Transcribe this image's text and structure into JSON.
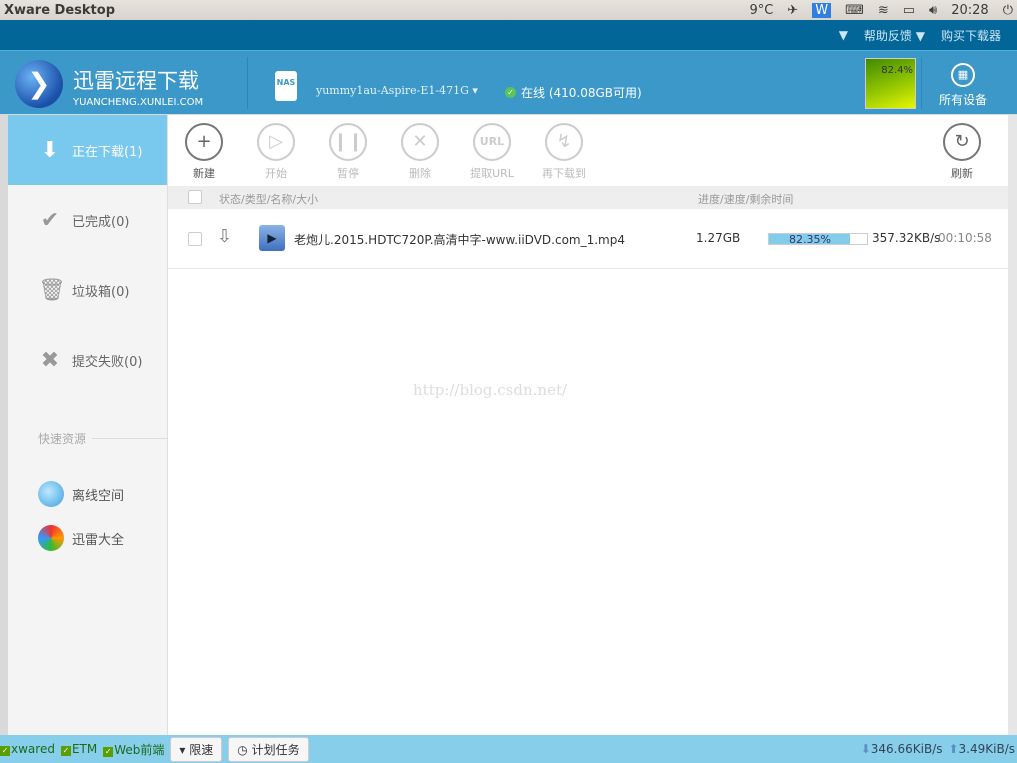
{
  "window": {
    "title": "Xware Desktop",
    "temp": "9°C",
    "clock": "20:28"
  },
  "topnav": {
    "help": "帮助反馈",
    "buy": "购买下载器"
  },
  "header": {
    "brand_cn": "迅雷远程下载",
    "brand_en": "YUANCHENG.XUNLEI.COM",
    "nas": "NAS",
    "device": "yummy1au-Aspire-E1-471G",
    "status": "在线 (410.08GB可用)",
    "graph_label": "82.4%",
    "all_devices": "所有设备"
  },
  "sidebar": {
    "items": [
      {
        "label": "正在下载(1)"
      },
      {
        "label": "已完成(0)"
      },
      {
        "label": "垃圾箱(0)"
      },
      {
        "label": "提交失败(0)"
      }
    ],
    "quick_label": "快速资源",
    "quick": [
      {
        "label": "离线空间"
      },
      {
        "label": "迅雷大全"
      }
    ]
  },
  "toolbar": {
    "new": "新建",
    "start": "开始",
    "pause": "暂停",
    "delete": "删除",
    "url_icon": "URL",
    "extract": "提取URL",
    "redownload": "再下载到",
    "refresh": "刷新"
  },
  "table": {
    "col1": "状态/类型/名称/大小",
    "col2": "进度/速度/剩余时间"
  },
  "task": {
    "name": "老炮儿.2015.HDTC720P.高清中字-www.iiDVD.com_1.mp4",
    "size": "1.27GB",
    "progress_pct": 82.35,
    "progress": "82.35%",
    "speed": "357.32KB/s",
    "remaining": "00:10:58"
  },
  "watermark": "http://blog.csdn.net/",
  "bottom": {
    "xwared": "xwared",
    "etm": "ETM",
    "web": "Web前端",
    "limit": "限速",
    "schedule": "计划任务",
    "down": "346.66KiB/s",
    "up": "3.49KiB/s"
  }
}
